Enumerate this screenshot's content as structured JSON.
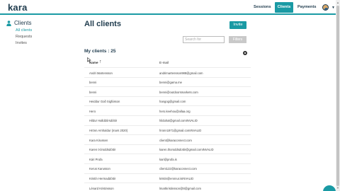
{
  "app": {
    "logo": "kara"
  },
  "nav": {
    "sessions": "Sessions",
    "clients": "Clients",
    "payments": "Payments"
  },
  "sidebar": {
    "title": "Clients",
    "items": [
      {
        "label": "All clients"
      },
      {
        "label": "Requests"
      },
      {
        "label": "Invites"
      }
    ]
  },
  "main": {
    "title": "All clients",
    "invite_label": "Invite",
    "search_placeholder": "Search for",
    "filters_label": "Filters",
    "count_label": "My clients : 25",
    "columns": {
      "name": "Name",
      "email": "E-mail"
    },
    "rows": [
      {
        "name": "Andri Martensson",
        "email": "andrimartensson988@gmail.com"
      },
      {
        "name": "benni",
        "email": "benni@gama.me"
      },
      {
        "name": "benni",
        "email": "benni@outdoorsmarkets.com"
      },
      {
        "name": "Heiddur Goð Sigfússon",
        "email": "hangog@gmail.com"
      },
      {
        "name": "Hero",
        "email": "hero.keehou@allaa.org"
      },
      {
        "name": "Hildur Hallddórsdóttir",
        "email": "hilduhal@gmail.comINVALID"
      },
      {
        "name": "Hrönn Arnhaldur (mars 2020)",
        "email": "hronn1971@gmail.comINVALID"
      },
      {
        "name": "Kara Kirussen",
        "email": "client@karaconnect.com"
      },
      {
        "name": "Karen Þóroddsdóttir",
        "email": "karen.thoroddsdottir@gmail.comINVALID"
      },
      {
        "name": "Kári Prufa",
        "email": "kari@prufa.is"
      },
      {
        "name": "Kerus Karusson",
        "email": "client122@karaconnect.com"
      },
      {
        "name": "Kristín Hermaddóttir",
        "email": "kristin@ennnur.isINVALID"
      },
      {
        "name": "Lénard Kristinsson",
        "email": "lmartkristinsson@8@gmail.com"
      }
    ]
  },
  "colors": {
    "accent": "#1a9aa4",
    "text_dark": "#1f3b4d"
  }
}
